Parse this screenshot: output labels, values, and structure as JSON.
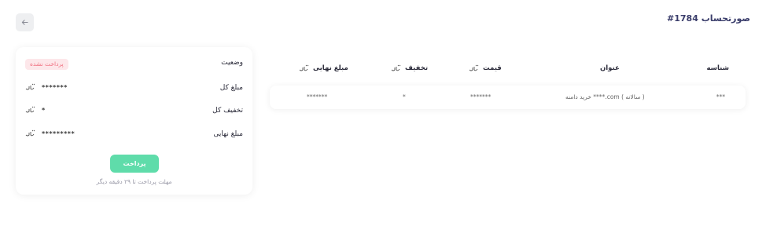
{
  "header": {
    "title": "صورتحساب 1784#"
  },
  "summary": {
    "status_label": "وضعیت",
    "status_badge": "پرداخت نشده",
    "total_label": "مبلغ کل",
    "total_value": "*******",
    "discount_label": "تخفیف کل",
    "discount_value": "*",
    "final_label": "مبلغ نهایی",
    "final_value": "*********",
    "pay_button": "پرداخت",
    "deadline_text": "مهلت پرداخت تا ۲۹ دقیقه دیگر"
  },
  "table": {
    "headers": {
      "id": "شناسه",
      "title": "عنوان",
      "price": "قیمت",
      "discount": "تخفیف",
      "final": "مبلغ نهایی"
    },
    "rows": [
      {
        "id": "***",
        "title": "خرید دامنه ****.com ( سالانه )",
        "price": "*******",
        "discount": "*",
        "final": "*******"
      }
    ]
  },
  "icons": {
    "back": "arrow-left-icon",
    "currency": "toman-icon"
  }
}
